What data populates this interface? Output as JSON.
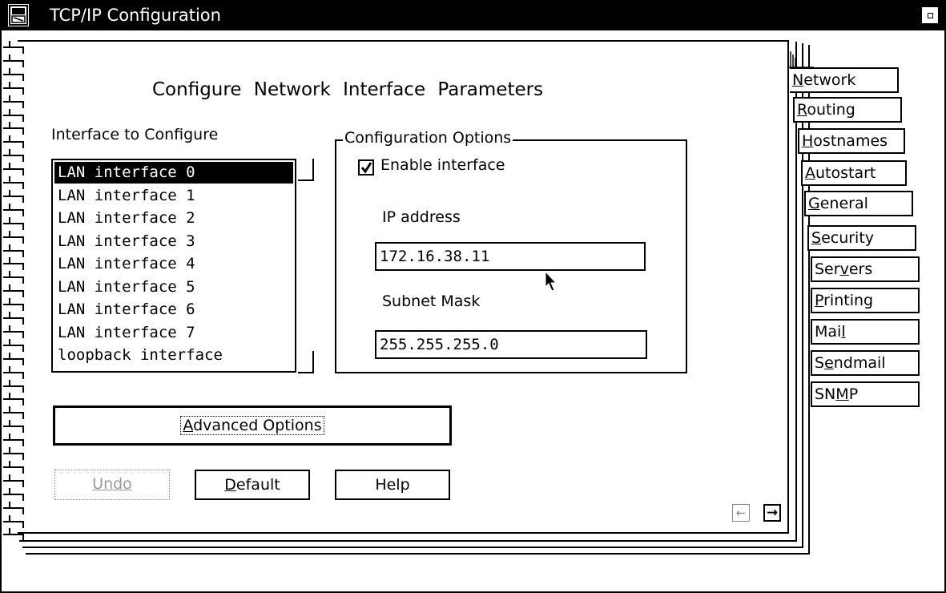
{
  "window": {
    "title": "TCP/IP Configuration",
    "system_menu_icon": "system-menu-icon",
    "maximize_icon": "maximize-icon"
  },
  "page": {
    "heading": "Configure  Network  Interface  Parameters"
  },
  "interfaces": {
    "label": "Interface to Configure",
    "items": [
      "LAN interface 0",
      "LAN interface 1",
      "LAN interface 2",
      "LAN interface 3",
      "LAN interface 4",
      "LAN interface 5",
      "LAN interface 6",
      "LAN interface 7",
      "loopback interface"
    ],
    "selected": "LAN interface 0"
  },
  "options": {
    "legend": "Configuration Options",
    "enable_label": "Enable interface",
    "enable_checked": true,
    "ip_label": "IP address",
    "ip_value": "172.16.38.11",
    "mask_label": "Subnet Mask",
    "mask_value": "255.255.255.0"
  },
  "buttons": {
    "advanced": "Advanced Options",
    "undo": "Undo",
    "default": "Default",
    "help": "Help"
  },
  "tabs": [
    {
      "label": "Network",
      "active": true
    },
    {
      "label": "Routing"
    },
    {
      "label": "Hostnames"
    },
    {
      "label": "Autostart"
    },
    {
      "label": "General"
    },
    {
      "label": "Security"
    },
    {
      "label": "Servers"
    },
    {
      "label": "Printing"
    },
    {
      "label": "Mail"
    },
    {
      "label": "Sendmail"
    },
    {
      "label": "SNMP"
    }
  ],
  "page_nav": {
    "prev_icon": "arrow-left-icon",
    "next_icon": "arrow-right-icon"
  }
}
